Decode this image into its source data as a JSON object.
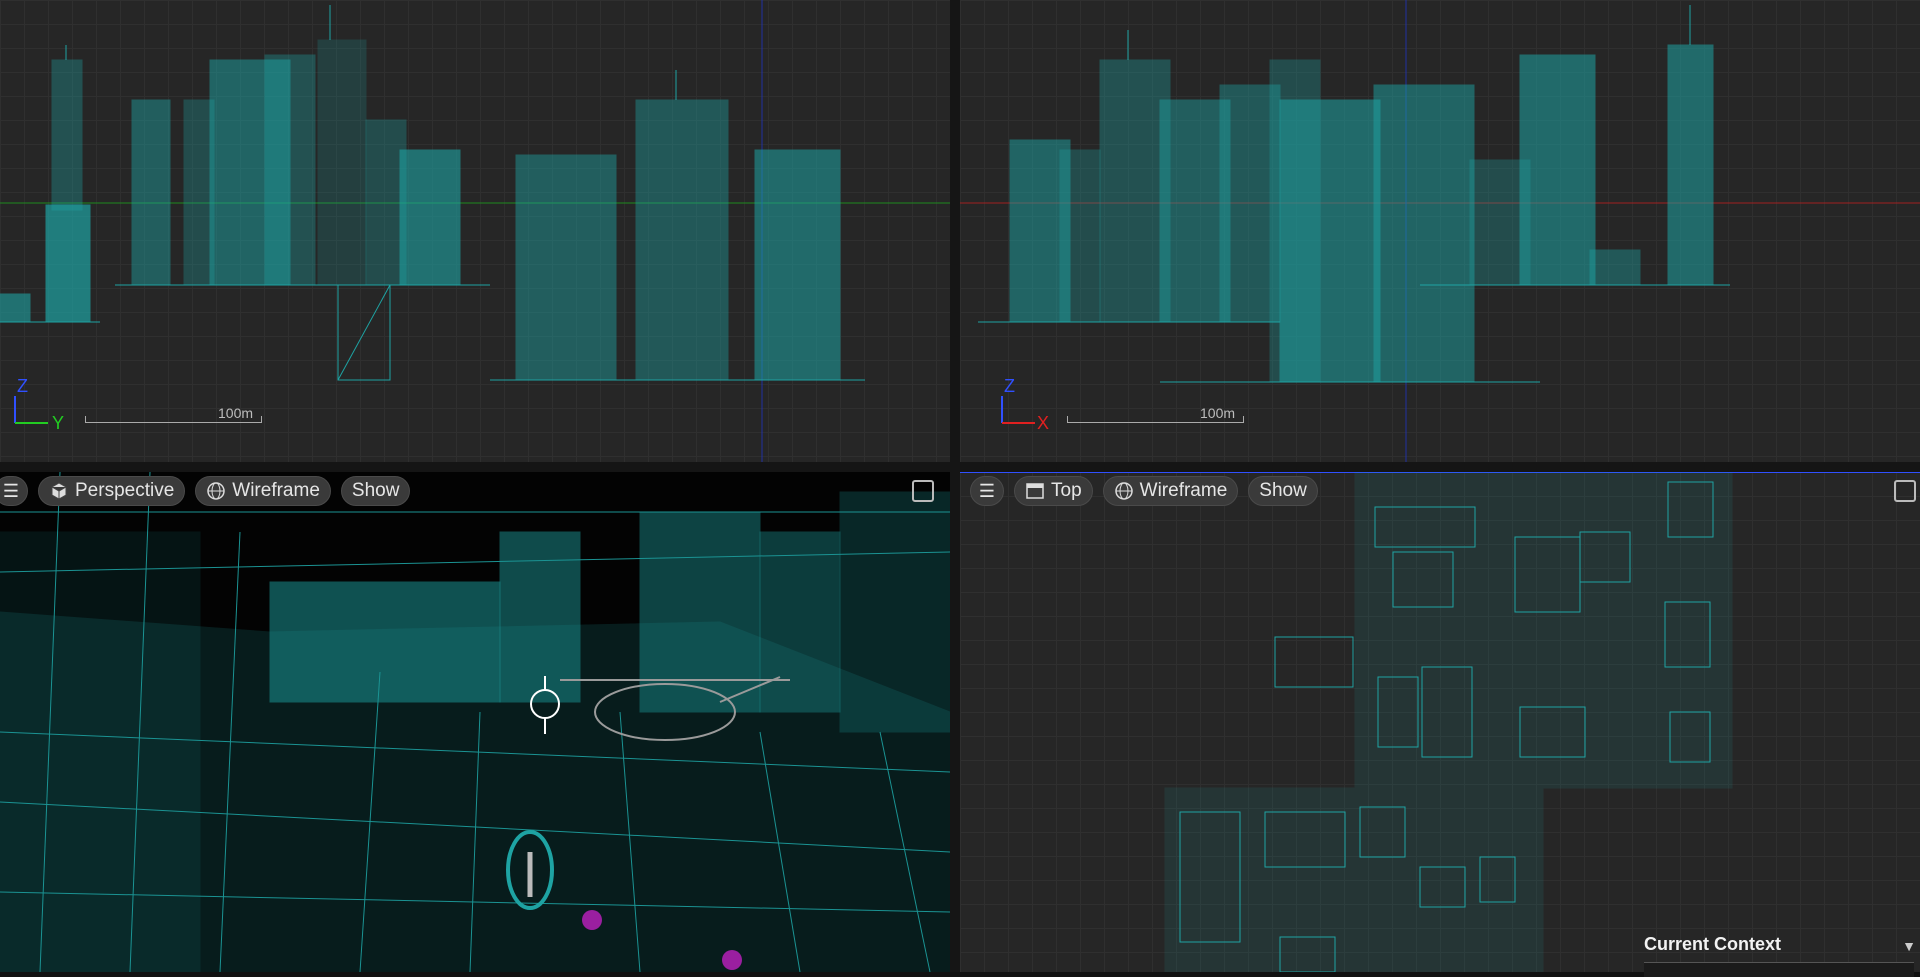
{
  "colors": {
    "wire": "#1ea3a3",
    "grid": "#2f2f2f",
    "axis_red": "#e02020",
    "axis_green": "#22cc22",
    "axis_blue": "#3050ff",
    "magenta": "#9a1fa0"
  },
  "front_view": {
    "axis_vertical": "Z",
    "axis_horizontal": "Y",
    "scale_label": "100m"
  },
  "side_view": {
    "axis_vertical": "Z",
    "axis_horizontal": "X",
    "scale_label": "100m"
  },
  "perspective_toolbar": {
    "menu_icon": "hamburger-icon",
    "view_mode": "Perspective",
    "view_icon": "cube-icon",
    "render_mode": "Wireframe",
    "render_icon": "globe-wireframe-icon",
    "show_label": "Show",
    "maximize_icon": "maximize-icon"
  },
  "top_toolbar": {
    "menu_icon": "hamburger-icon",
    "view_mode": "Top",
    "view_icon": "ortho-window-icon",
    "render_mode": "Wireframe",
    "render_icon": "globe-wireframe-icon",
    "show_label": "Show",
    "maximize_icon": "maximize-icon"
  },
  "context_panel": {
    "title": "Current Context"
  }
}
